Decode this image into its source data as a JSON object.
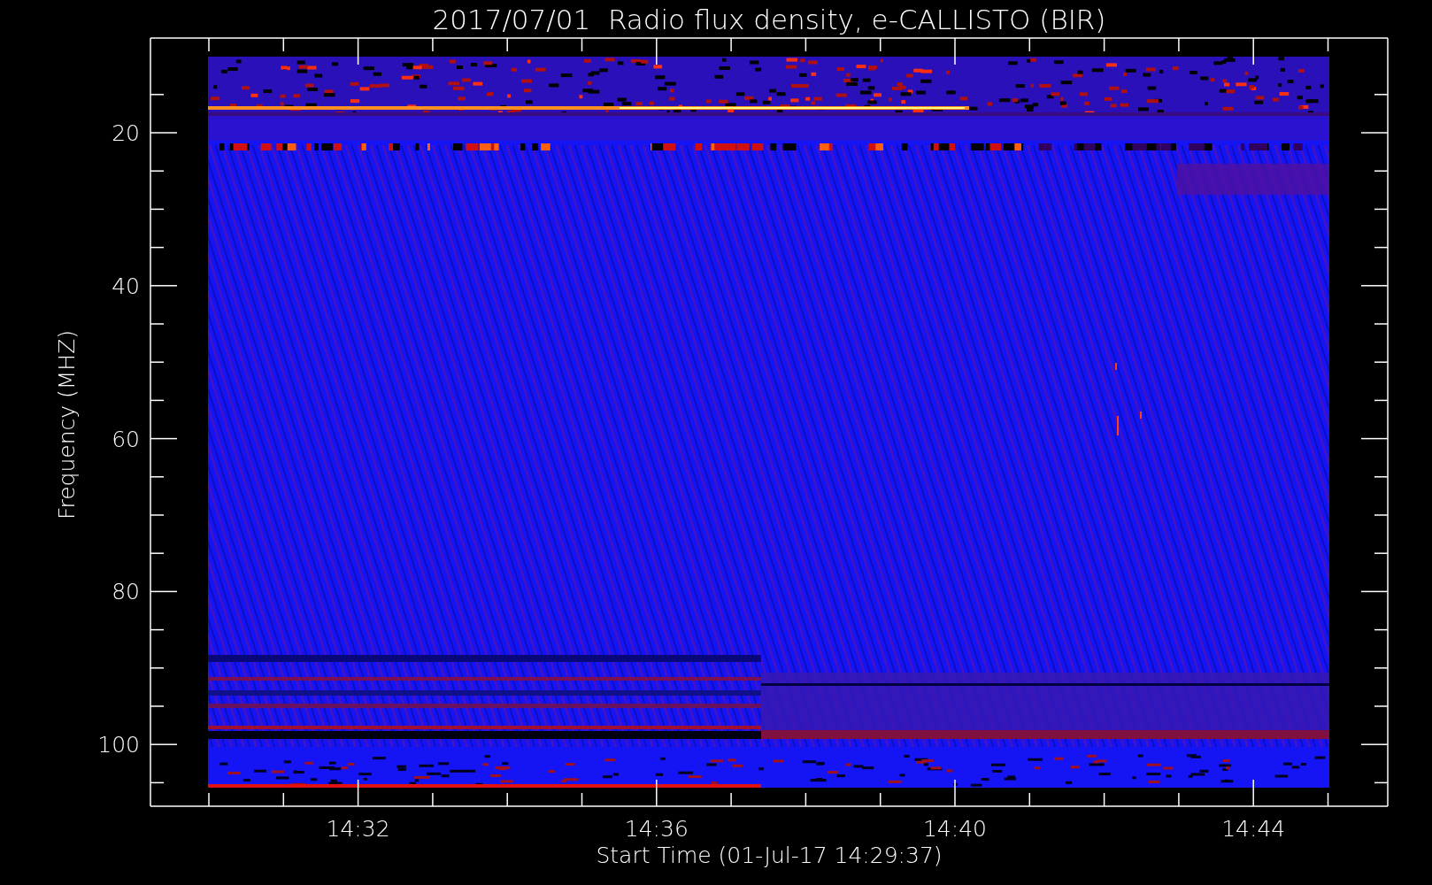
{
  "title": "2017/07/01  Radio flux density, e-CALLISTO (BIR)",
  "y_axis": {
    "label": "Frequency (MHZ)",
    "ticks": [
      "20",
      "40",
      "60",
      "80",
      "100"
    ]
  },
  "x_axis": {
    "label": "Start Time (01-Jul-17 14:29:37)",
    "ticks": [
      "14:32",
      "14:36",
      "14:40",
      "14:44"
    ]
  }
}
